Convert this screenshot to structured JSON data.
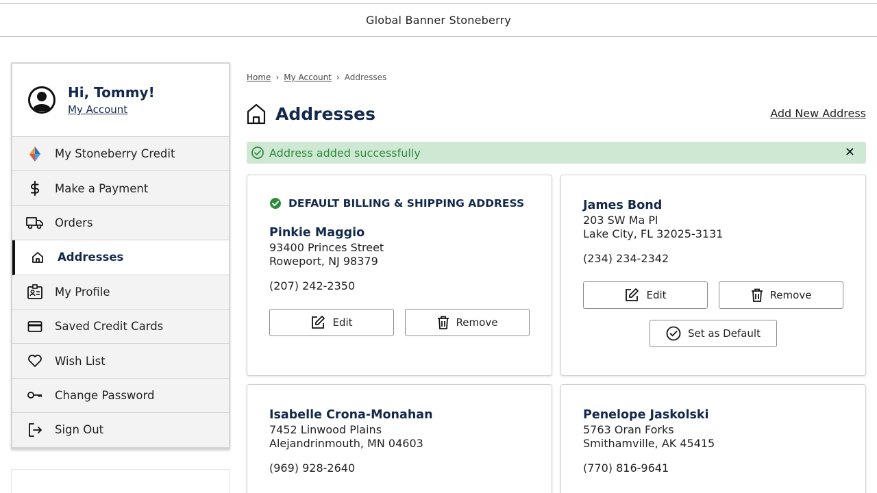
{
  "banner": {
    "text": "Global Banner Stoneberry"
  },
  "sidebar": {
    "greeting": "Hi, Tommy!",
    "account_link": "My Account",
    "items": [
      {
        "label": "My Stoneberry Credit",
        "icon": "stoneberry-credit-icon"
      },
      {
        "label": "Make a Payment",
        "icon": "dollar-icon"
      },
      {
        "label": "Orders",
        "icon": "truck-icon"
      },
      {
        "label": "Addresses",
        "icon": "home-icon",
        "active": true
      },
      {
        "label": "My Profile",
        "icon": "profile-badge-icon"
      },
      {
        "label": "Saved Credit Cards",
        "icon": "credit-card-icon"
      },
      {
        "label": "Wish List",
        "icon": "heart-icon"
      },
      {
        "label": "Change Password",
        "icon": "key-icon"
      },
      {
        "label": "Sign Out",
        "icon": "sign-out-icon"
      }
    ]
  },
  "breadcrumb": {
    "home": "Home",
    "account": "My Account",
    "current": "Addresses"
  },
  "page": {
    "title": "Addresses",
    "add_link": "Add New Address"
  },
  "alert": {
    "message": "Address added successfully",
    "close": "✕"
  },
  "addresses": [
    {
      "default_label": "DEFAULT BILLING & SHIPPING ADDRESS",
      "name": "Pinkie Maggio",
      "street": "93400 Princes Street",
      "city": "Roweport, NJ 98379",
      "phone": "(207) 242-2350",
      "edit": "Edit",
      "remove": "Remove"
    },
    {
      "name": "James Bond",
      "street": "203 SW Ma Pl",
      "city": "Lake City, FL 32025-3131",
      "phone": "(234) 234-2342",
      "edit": "Edit",
      "remove": "Remove",
      "set_default": "Set as Default"
    },
    {
      "name": "Isabelle Crona-Monahan",
      "street": "7452 Linwood Plains",
      "city": "Alejandrinmouth, MN 04603",
      "phone": "(969) 928-2640"
    },
    {
      "name": "Penelope Jaskolski",
      "street": "5763 Oran Forks",
      "city": "Smithamville, AK 45415",
      "phone": "(770) 816-9641"
    }
  ],
  "colors": {
    "navy": "#13294b",
    "success_bg": "#cfe8d4",
    "success_text": "#2e8b3e"
  }
}
